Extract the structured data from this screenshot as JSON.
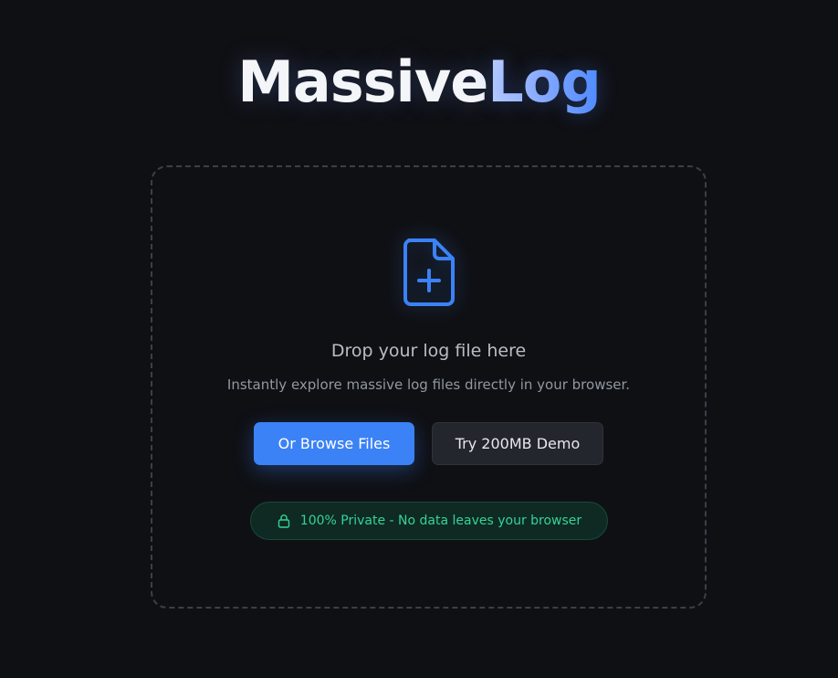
{
  "brand": {
    "part1": "Massive",
    "part2": "Log"
  },
  "dropzone": {
    "icon": "file-plus-icon",
    "title": "Drop your log file here",
    "subtitle": "Instantly explore massive log files directly in your browser.",
    "browse_label": "Or Browse Files",
    "demo_label": "Try 200MB Demo",
    "privacy_icon": "lock-icon",
    "privacy_text": "100% Private - No data leaves your browser"
  },
  "colors": {
    "background": "#0f1014",
    "accent": "#3b82f6",
    "privacy_green": "#34d399"
  }
}
